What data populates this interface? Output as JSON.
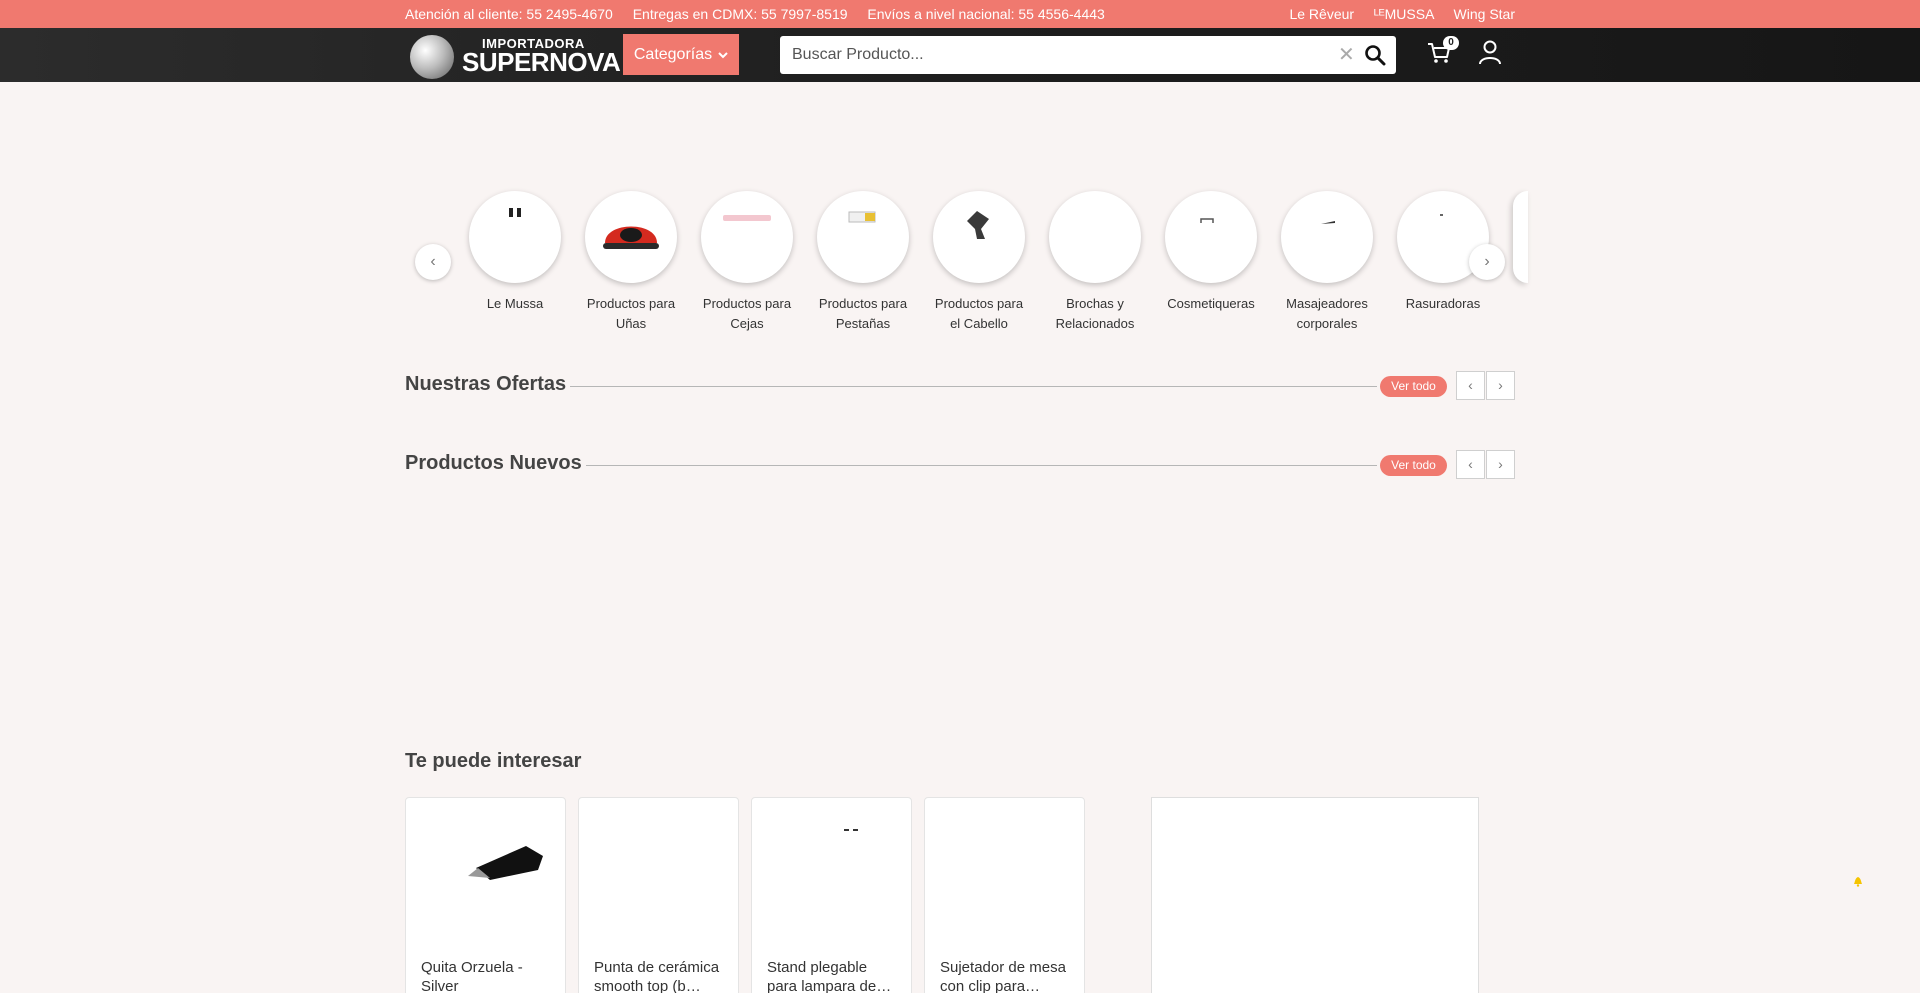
{
  "topbar": {
    "contacts": [
      "Atención al cliente: 55 2495-4670",
      "Entregas en CDMX: 55 7997-8519",
      "Envíos a nivel nacional: 55 4556-4443"
    ],
    "brands": [
      "Le Rêveur",
      "ᴸᴱMUSSA",
      "Wing Star"
    ]
  },
  "header": {
    "logo_small": "IMPORTADORA",
    "logo_big": "SUPERNOVA",
    "categories_label": "Categorías",
    "search_placeholder": "Buscar Producto...",
    "cart_count": "0",
    "icons": [
      "chevron-down-icon",
      "close-icon",
      "search-icon",
      "cart-icon",
      "user-icon"
    ]
  },
  "categories": {
    "items": [
      {
        "line1": "Le Mussa",
        "line2": ""
      },
      {
        "line1": "Productos para",
        "line2": "Uñas"
      },
      {
        "line1": "Productos para",
        "line2": "Cejas"
      },
      {
        "line1": "Productos para",
        "line2": "Pestañas"
      },
      {
        "line1": "Productos para",
        "line2": "el Cabello"
      },
      {
        "line1": "Brochas y",
        "line2": "Relacionados"
      },
      {
        "line1": "Cosmetiqueras",
        "line2": ""
      },
      {
        "line1": "Masajeadores",
        "line2": "corporales"
      },
      {
        "line1": "Rasuradoras",
        "line2": ""
      }
    ],
    "prev_icon": "‹",
    "next_icon": "›"
  },
  "sections": {
    "ofertas": {
      "title": "Nuestras Ofertas",
      "ver_todo": "Ver todo"
    },
    "nuevos": {
      "title": "Productos Nuevos",
      "ver_todo": "Ver todo"
    },
    "arrow_prev": "‹",
    "arrow_next": "›"
  },
  "interest": {
    "title": "Te puede interesar",
    "products": [
      {
        "name": "Quita Orzuela - Silver"
      },
      {
        "name": "Punta de cerámica smooth top (b…"
      },
      {
        "name": "Stand plegable para lampara de…"
      },
      {
        "name": "Sujetador de mesa con clip para…"
      }
    ]
  },
  "colors": {
    "accent": "#f0796f",
    "header_bg": "#1e1e1e",
    "page_bg": "#f9f4f3"
  }
}
